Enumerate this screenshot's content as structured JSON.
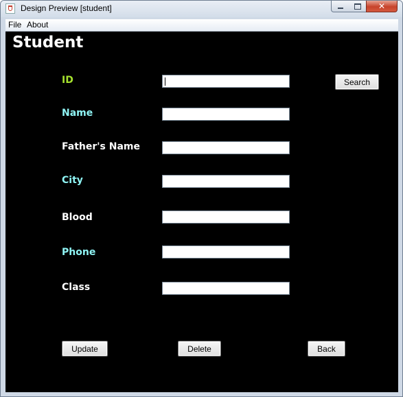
{
  "window": {
    "title": "Design Preview [student]",
    "close_glyph": "✕"
  },
  "menu": {
    "file": "File",
    "about": "About"
  },
  "form": {
    "heading": "Student",
    "search_label": "Search",
    "fields": [
      {
        "label": "ID",
        "color": "#a6e22e",
        "value": ""
      },
      {
        "label": "Name",
        "color": "#8ff4f4",
        "value": ""
      },
      {
        "label": "Father's Name",
        "color": "#ffffff",
        "value": ""
      },
      {
        "label": "City",
        "color": "#8ff4f4",
        "value": ""
      },
      {
        "label": "Blood",
        "color": "#ffffff",
        "value": ""
      },
      {
        "label": "Phone",
        "color": "#8ff4f4",
        "value": ""
      },
      {
        "label": "Class",
        "color": "#ffffff",
        "value": ""
      }
    ],
    "buttons": {
      "update": "Update",
      "delete": "Delete",
      "back": "Back"
    }
  },
  "colors": {
    "background": "#000000",
    "heading": "#ffffff"
  }
}
